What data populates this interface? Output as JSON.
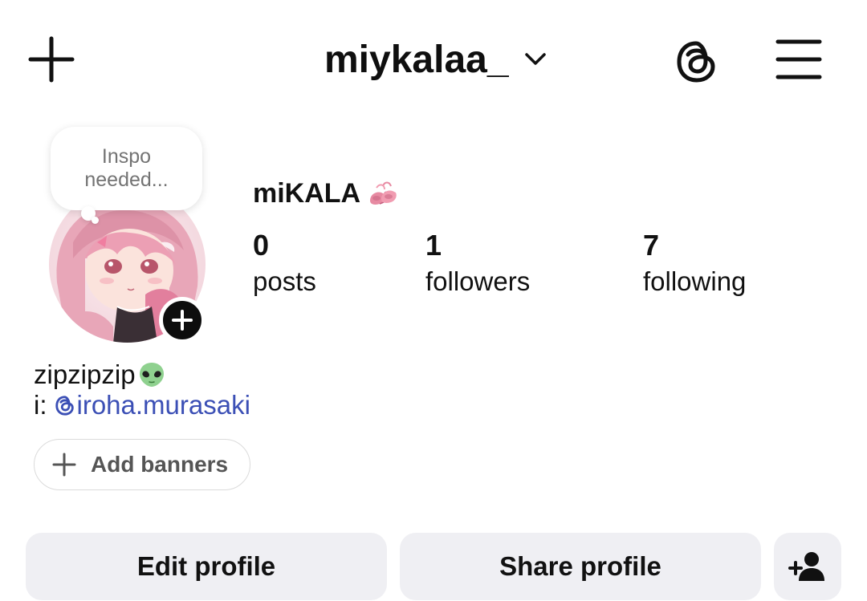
{
  "header": {
    "username": "miykalaa_"
  },
  "note": {
    "text": "Inspo needed..."
  },
  "profile": {
    "display_name": "miKALA",
    "display_name_emoji": "ballet-shoes-emoji"
  },
  "stats": {
    "posts": {
      "count": "0",
      "label": "posts"
    },
    "followers": {
      "count": "1",
      "label": "followers"
    },
    "following": {
      "count": "7",
      "label": "following"
    }
  },
  "bio": {
    "line1": "zipzipzip",
    "line1_emoji": "alien-emoji",
    "line2_prefix": "i:",
    "mention": "iroha.murasaki"
  },
  "add_banners": {
    "label": "Add banners"
  },
  "actions": {
    "edit_profile": "Edit profile",
    "share_profile": "Share profile"
  },
  "icons": {
    "create": "plus-icon",
    "username_menu": "chevron-down-icon",
    "threads": "threads-icon",
    "menu": "hamburger-menu-icon",
    "add_story": "plus-icon",
    "add_banners": "plus-icon",
    "discover_people": "add-person-icon"
  },
  "colors": {
    "background": "#ffffff",
    "text": "#111111",
    "muted": "#737373",
    "mention": "#3b4fb5",
    "button_bg": "#efeff3",
    "border": "#dbdbdb"
  }
}
